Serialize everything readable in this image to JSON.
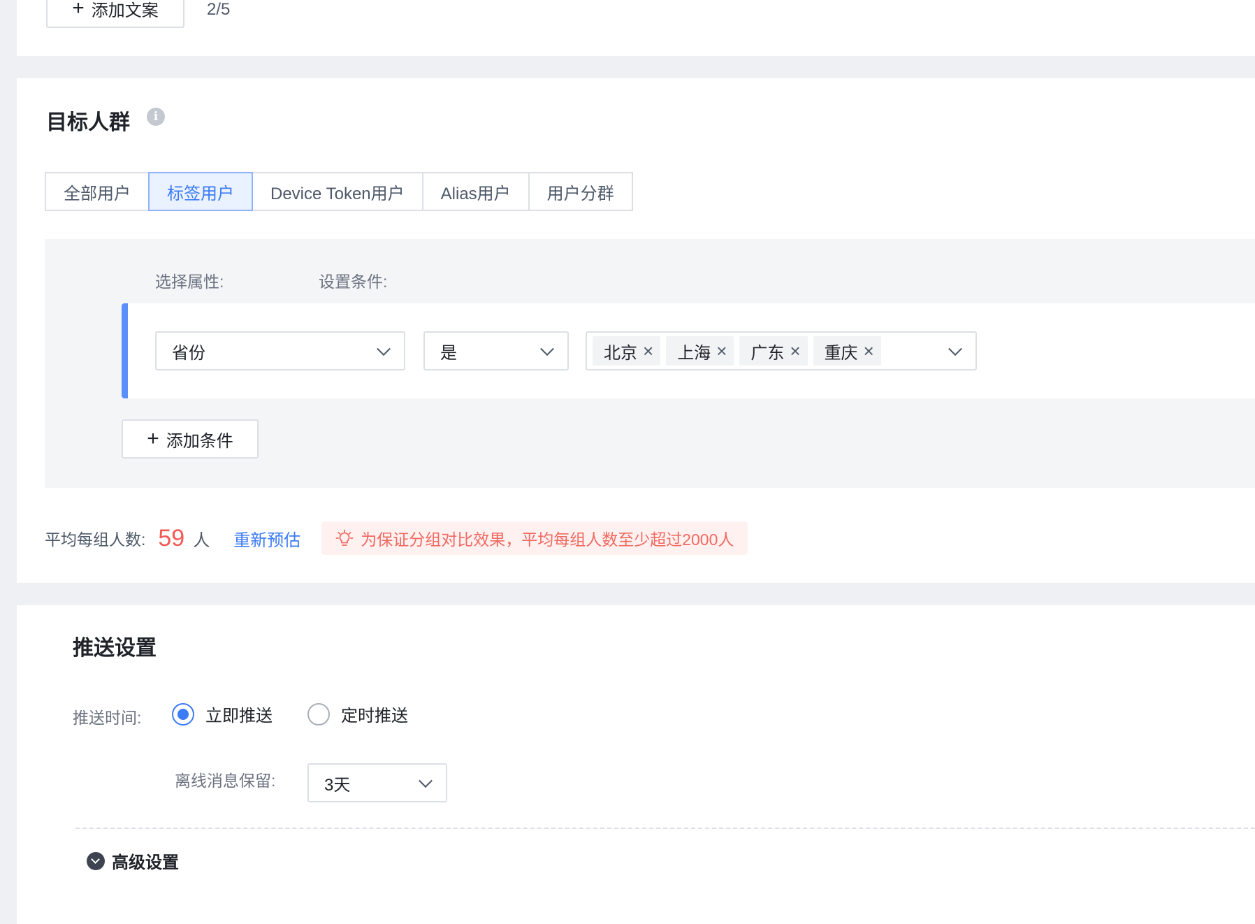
{
  "top": {
    "add_copy_label": "添加文案",
    "count": "2/5"
  },
  "target": {
    "title": "目标人群",
    "info_icon": "i",
    "tabs": [
      {
        "label": "全部用户",
        "active": false
      },
      {
        "label": "标签用户",
        "active": true
      },
      {
        "label": "Device Token用户",
        "active": false
      },
      {
        "label": "Alias用户",
        "active": false
      },
      {
        "label": "用户分群",
        "active": false
      }
    ],
    "select_attr_label": "选择属性:",
    "set_cond_label": "设置条件:",
    "condition": {
      "attribute": "省份",
      "operator": "是",
      "values": [
        "北京",
        "上海",
        "广东",
        "重庆"
      ]
    },
    "add_condition_label": "添加条件",
    "avg_label": "平均每组人数:",
    "avg_value": "59",
    "avg_unit": "人",
    "re_estimate": "重新预估",
    "warning": "为保证分组对比效果，平均每组人数至少超过2000人"
  },
  "push": {
    "title": "推送设置",
    "time_label": "推送时间:",
    "options": [
      {
        "label": "立即推送",
        "selected": true
      },
      {
        "label": "定时推送",
        "selected": false
      }
    ],
    "offline_label": "离线消息保留:",
    "offline_value": "3天",
    "advanced_label": "高级设置"
  },
  "colors": {
    "accent": "#3c7bf6",
    "danger": "#f25a55",
    "bar": "#5b8ff9"
  }
}
